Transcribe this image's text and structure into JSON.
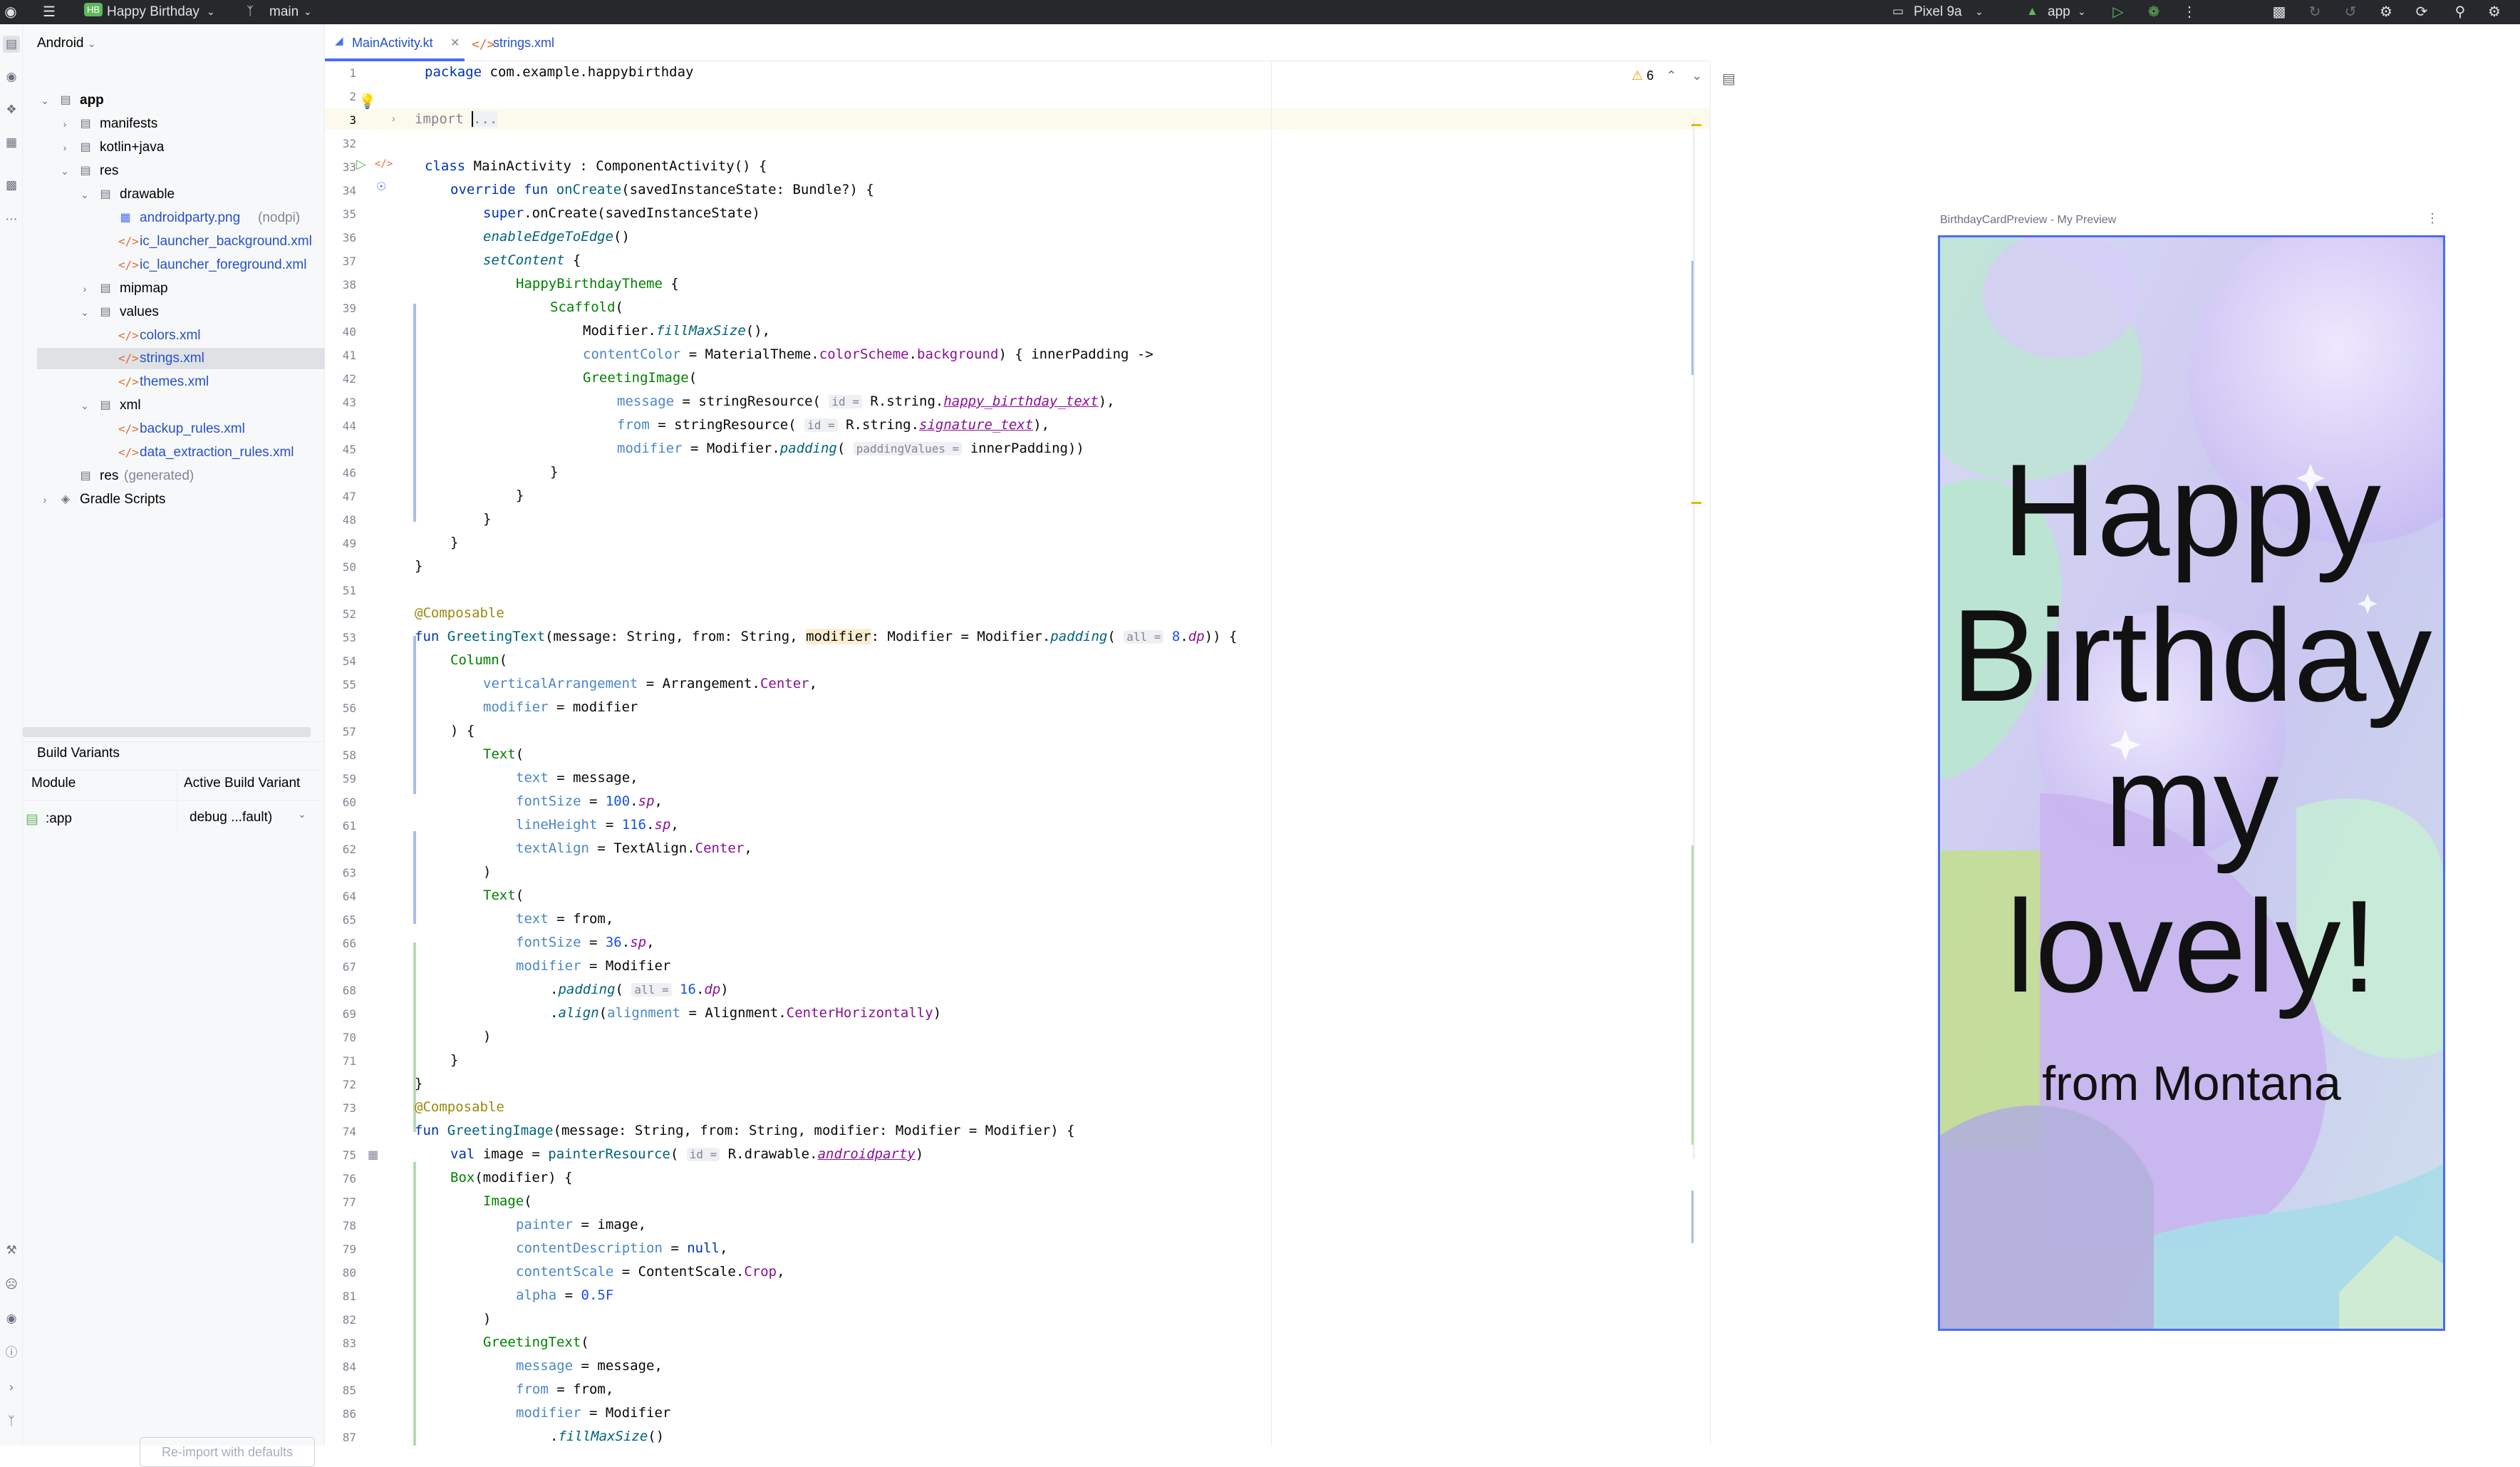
{
  "titlebar": {
    "project_badge": "HB",
    "project_name": "Happy Birthday",
    "branch": "main",
    "device": "Pixel 9a",
    "run_config": "app"
  },
  "project_panel": {
    "view_selector": "Android",
    "tree": [
      {
        "label": "app",
        "kind": "module"
      },
      {
        "label": "manifests",
        "kind": "folder"
      },
      {
        "label": "kotlin+java",
        "kind": "folder"
      },
      {
        "label": "res",
        "kind": "folder"
      },
      {
        "label": "drawable",
        "kind": "folder"
      },
      {
        "label": "androidparty.png",
        "suffix": "(nodpi)",
        "kind": "image"
      },
      {
        "label": "ic_launcher_background.xml",
        "kind": "xml"
      },
      {
        "label": "ic_launcher_foreground.xml",
        "kind": "xml"
      },
      {
        "label": "mipmap",
        "kind": "folder"
      },
      {
        "label": "values",
        "kind": "folder"
      },
      {
        "label": "colors.xml",
        "kind": "xml"
      },
      {
        "label": "strings.xml",
        "kind": "xml",
        "selected": true
      },
      {
        "label": "themes.xml",
        "kind": "xml"
      },
      {
        "label": "xml",
        "kind": "folder"
      },
      {
        "label": "backup_rules.xml",
        "kind": "xml"
      },
      {
        "label": "data_extraction_rules.xml",
        "kind": "xml"
      },
      {
        "label": "res",
        "suffix": "(generated)",
        "kind": "folder"
      },
      {
        "label": "Gradle Scripts",
        "kind": "gradle"
      }
    ]
  },
  "build_variants": {
    "title": "Build Variants",
    "col_module": "Module",
    "col_variant": "Active Build Variant",
    "row_module": ":app",
    "row_variant": "debug ...fault)",
    "reimport_button": "Re-import with defaults"
  },
  "editor": {
    "tabs": [
      {
        "label": "MainActivity.kt",
        "active": true
      },
      {
        "label": "strings.xml",
        "active": false
      }
    ],
    "warnings_count": "6",
    "line_numbers": [
      "1",
      "2",
      "3",
      "32",
      "33",
      "34",
      "35",
      "36",
      "37",
      "38",
      "39",
      "40",
      "41",
      "42",
      "43",
      "44",
      "45",
      "46",
      "47",
      "48",
      "49",
      "50",
      "51",
      "52",
      "53",
      "54",
      "55",
      "56",
      "57",
      "58",
      "59",
      "60",
      "61",
      "62",
      "63",
      "64",
      "65",
      "66",
      "67",
      "68",
      "69",
      "70",
      "71",
      "72",
      "73",
      "74",
      "75",
      "76",
      "77",
      "78",
      "79",
      "80",
      "81",
      "82",
      "83",
      "84",
      "85",
      "86",
      "87"
    ]
  },
  "preview": {
    "title": "BirthdayCardPreview - My Preview",
    "greeting": "Happy Birthday my lovely!",
    "from_text": "from Montana"
  },
  "colors": {
    "accent": "#4a6cf7",
    "selection": "#dfe1e5",
    "titlebar_bg": "#27282c"
  }
}
